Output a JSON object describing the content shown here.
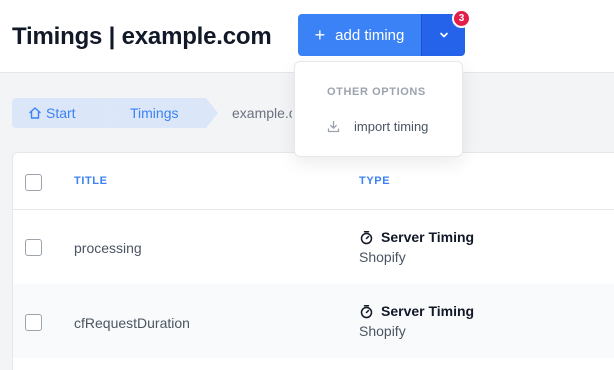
{
  "header": {
    "title": "Timings | example.com",
    "add_button_label": "add timing",
    "notification_count": "3"
  },
  "breadcrumb": {
    "items": [
      {
        "label": "Start"
      },
      {
        "label": "Timings"
      },
      {
        "label": "example.com"
      }
    ]
  },
  "dropdown": {
    "heading": "OTHER OPTIONS",
    "items": [
      {
        "label": "import timing",
        "icon": "download-icon"
      }
    ]
  },
  "table": {
    "columns": [
      "TITLE",
      "TYPE"
    ],
    "rows": [
      {
        "title": "processing",
        "type": "Server Timing",
        "source": "Shopify",
        "icon": "stopwatch-icon"
      },
      {
        "title": "cfRequestDuration",
        "type": "Server Timing",
        "source": "Shopify",
        "icon": "stopwatch-icon"
      }
    ]
  },
  "colors": {
    "accent": "#3b82f6",
    "accent_dark": "#2563eb",
    "badge": "#e11d48",
    "breadcrumb_bg": "#dbe7f8"
  }
}
